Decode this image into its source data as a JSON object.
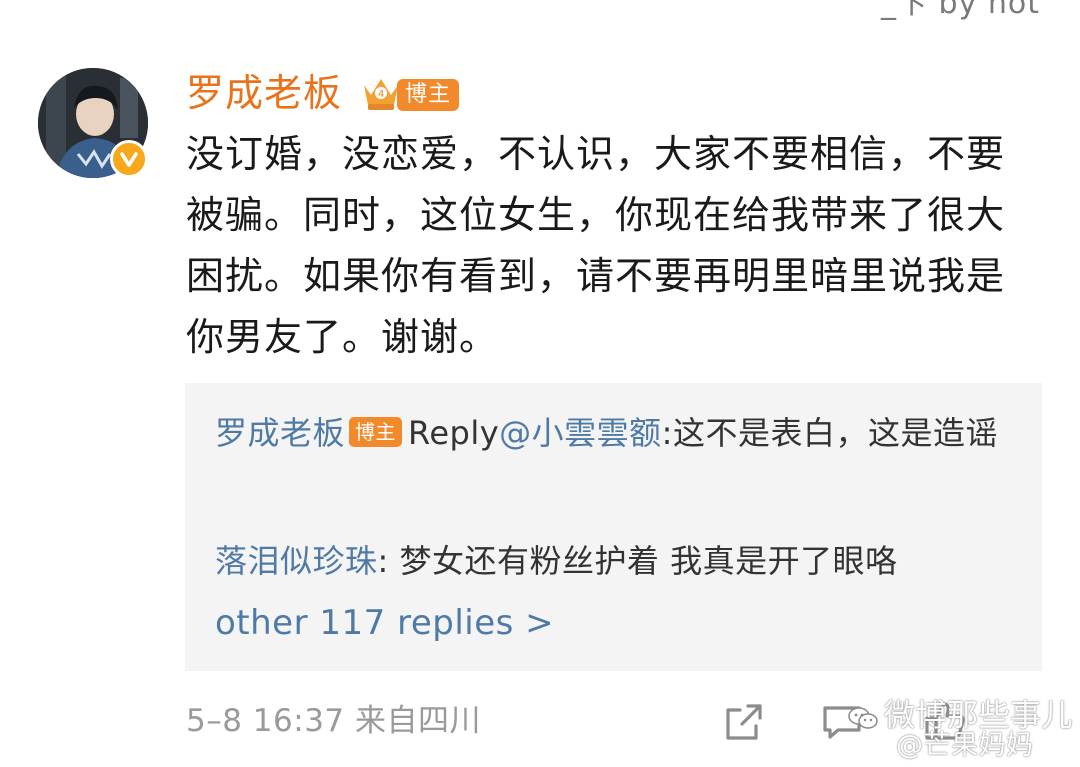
{
  "top_fragment": "_卞 by not",
  "post": {
    "username": "罗成老板",
    "rank_icon": "crown-level-icon",
    "badge": "博主",
    "verified_icon": "verified-v-icon",
    "text": "没订婚，没恋爱，不认识，大家不要相信，不要被骗。同时，这位女生，你现在给我带来了很大困扰。如果你有看到，请不要再明里暗里说我是你男友了。谢谢。"
  },
  "replies": {
    "items": [
      {
        "user": "罗成老板",
        "badge": "博主",
        "reply_prefix": "Reply",
        "mention": "@小雲雲额",
        "text": ":这不是表白，这是造谣"
      },
      {
        "user": "落泪似珍珠",
        "text": ": 梦女还有粉丝护着 我真是开了眼咯"
      }
    ],
    "more": "other 117 replies >"
  },
  "footer": {
    "time_source": "5–8 16:37  来自四川",
    "icons": [
      "share-icon",
      "comment-icon",
      "like-icon"
    ]
  },
  "watermark": {
    "line1": "微博那些事儿",
    "line2": "@芒果妈妈",
    "icon": "wechat-icon"
  },
  "colors": {
    "username": "#e8731b",
    "badge": "#f28a2c",
    "link": "#4f7aa5",
    "reply_bg": "#f4f4f4",
    "meta": "#9a9a9a"
  }
}
